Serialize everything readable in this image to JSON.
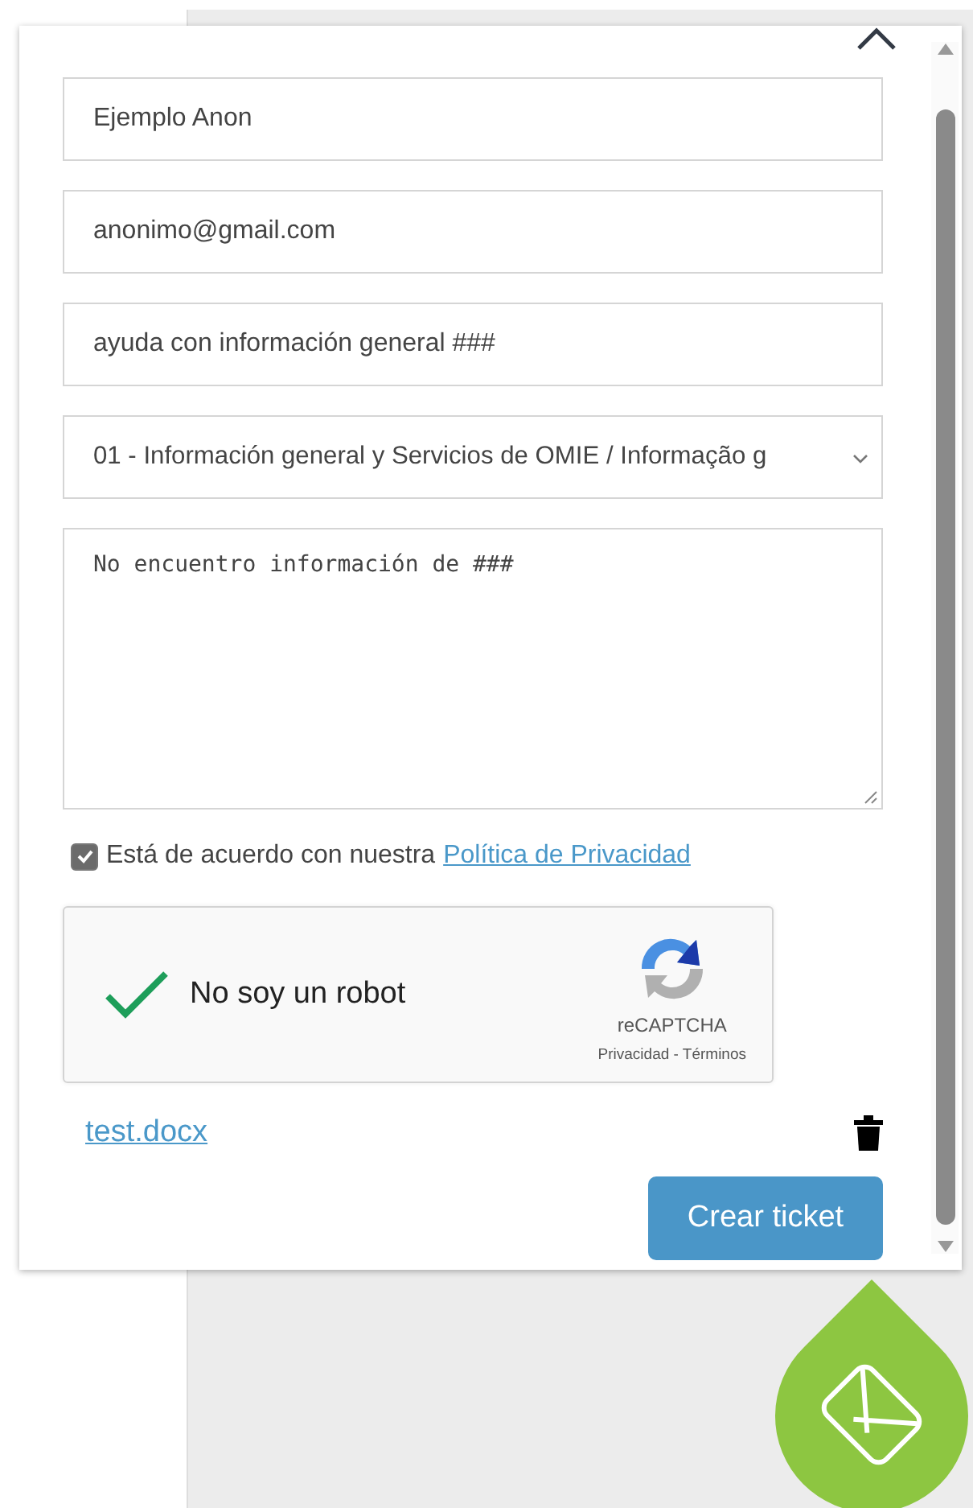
{
  "form": {
    "fields": [
      {
        "kind": "input",
        "value": "Ejemplo Anon"
      },
      {
        "kind": "input",
        "value": "anonimo@gmail.com"
      },
      {
        "kind": "input",
        "value": "ayuda con información general ###"
      },
      {
        "kind": "select",
        "value": "01 - Información general y Servicios de OMIE / Informação g"
      },
      {
        "kind": "textarea",
        "value": "No encuentro información de ###"
      }
    ],
    "consent": {
      "checked": true,
      "text": "Está de acuerdo con nuestra",
      "link": "Política de Privacidad"
    },
    "captcha": {
      "checked": true,
      "label": "No soy un robot",
      "brand": "reCAPTCHA",
      "terms": "Privacidad - Términos"
    },
    "attachment": {
      "name": "test.docx"
    },
    "submit": "Crear ticket"
  }
}
